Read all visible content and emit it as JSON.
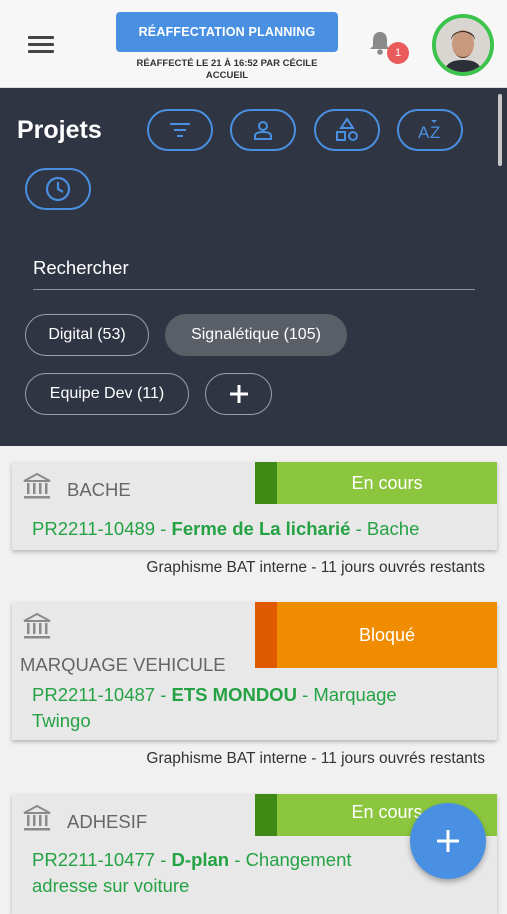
{
  "header": {
    "reassign_button": "RÉAFFECTATION PLANNING",
    "reassign_info": "RÉAFFECTÉ LE 21 À 16:52 PAR CÉCILE ACCUEIL",
    "notification_count": "1"
  },
  "projects": {
    "title": "Projets",
    "filter_icons": [
      "filter-icon",
      "user-icon",
      "shapes-icon",
      "sort-az-icon",
      "clock-icon"
    ],
    "search_placeholder": "Rechercher",
    "chips": [
      {
        "label": "Digital (53)",
        "active": false
      },
      {
        "label": "Signalétique (105)",
        "active": true
      },
      {
        "label": "Equipe Dev (11)",
        "active": false
      }
    ],
    "add_chip": "+"
  },
  "cards": [
    {
      "category": "BACHE",
      "status": "En cours",
      "ref": "PR2211-10489",
      "client": "Ferme de La licharié",
      "suffix": "Bache",
      "meta": "Graphisme BAT interne - 11 jours ouvrés restants"
    },
    {
      "category": "MARQUAGE VEHICULE",
      "status": "Bloqué",
      "ref": "PR2211-10487",
      "client": "ETS MONDOU",
      "suffix": "Marquage Twingo",
      "meta": "Graphisme BAT interne - 11 jours ouvrés restants"
    },
    {
      "category": "ADHESIF",
      "status": "En cours",
      "ref": "PR2211-10477",
      "client": "D-plan",
      "suffix": "Changement adresse sur voiture",
      "meta": ""
    }
  ],
  "colors": {
    "accent": "#4a90e2",
    "dark_panel": "#2f3542",
    "status_en_cours": "#8cc63f",
    "status_en_cours_strip": "#3f8a14",
    "status_bloque": "#f08c00",
    "status_bloque_strip": "#e05a00",
    "link_green": "#25a244"
  }
}
